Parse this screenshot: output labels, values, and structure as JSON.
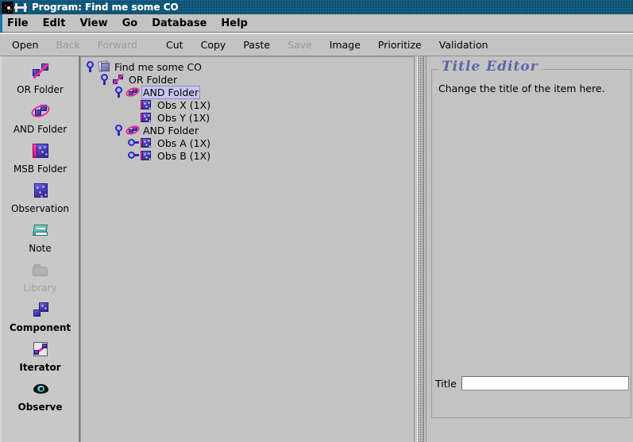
{
  "window": {
    "title": "Program: Find me some CO",
    "app_icon": "nebula-image-icon",
    "window_icon": "window-handles-icon"
  },
  "menubar": {
    "items": [
      {
        "label": "File"
      },
      {
        "label": "Edit"
      },
      {
        "label": "View"
      },
      {
        "label": "Go"
      },
      {
        "label": "Database"
      },
      {
        "label": "Help"
      }
    ]
  },
  "toolbar": {
    "buttons": [
      {
        "label": "Open",
        "enabled": true
      },
      {
        "label": "Back",
        "enabled": false
      },
      {
        "label": "Forward",
        "enabled": false
      },
      {
        "label": "Cut",
        "enabled": true
      },
      {
        "label": "Copy",
        "enabled": true
      },
      {
        "label": "Paste",
        "enabled": true
      },
      {
        "label": "Save",
        "enabled": false
      },
      {
        "label": "Image",
        "enabled": true
      },
      {
        "label": "Prioritize",
        "enabled": true
      },
      {
        "label": "Validation",
        "enabled": true
      }
    ]
  },
  "palette": {
    "items": [
      {
        "label": "OR Folder",
        "icon": "or-folder-icon",
        "enabled": true,
        "bold": false
      },
      {
        "label": "AND Folder",
        "icon": "and-folder-icon",
        "enabled": true,
        "bold": false
      },
      {
        "label": "MSB Folder",
        "icon": "msb-folder-icon",
        "enabled": true,
        "bold": false
      },
      {
        "label": "Observation",
        "icon": "observation-icon",
        "enabled": true,
        "bold": false
      },
      {
        "label": "Note",
        "icon": "note-icon",
        "enabled": true,
        "bold": false
      },
      {
        "label": "Library",
        "icon": "library-icon",
        "enabled": false,
        "bold": false
      },
      {
        "label": "Component",
        "icon": "component-icon",
        "enabled": true,
        "bold": true
      },
      {
        "label": "Iterator",
        "icon": "iterator-icon",
        "enabled": true,
        "bold": true
      },
      {
        "label": "Observe",
        "icon": "observe-eye-icon",
        "enabled": true,
        "bold": true
      }
    ]
  },
  "tree": {
    "nodes": [
      {
        "label": "Find me some CO",
        "icon": "program-doc-icon",
        "depth": 0,
        "toggle": "expanded",
        "selected": false
      },
      {
        "label": "OR Folder",
        "icon": "or-folder-icon",
        "depth": 1,
        "toggle": "expanded",
        "selected": false
      },
      {
        "label": "AND Folder",
        "icon": "and-folder-icon",
        "depth": 2,
        "toggle": "expanded",
        "selected": true
      },
      {
        "label": "Obs X (1X)",
        "icon": "observation-icon",
        "depth": 3,
        "toggle": "none",
        "selected": false
      },
      {
        "label": "Obs Y (1X)",
        "icon": "observation-icon",
        "depth": 3,
        "toggle": "none",
        "selected": false
      },
      {
        "label": "AND Folder",
        "icon": "and-folder-icon",
        "depth": 2,
        "toggle": "expanded",
        "selected": false
      },
      {
        "label": "Obs A (1X)",
        "icon": "observation-icon",
        "depth": 3,
        "toggle": "collapsed",
        "selected": false
      },
      {
        "label": "Obs B (1X)",
        "icon": "observation-icon",
        "depth": 3,
        "toggle": "collapsed",
        "selected": false
      }
    ]
  },
  "editor": {
    "panel_title": "Title Editor",
    "description": "Change the title of the item here.",
    "field_label": "Title",
    "field_value": "",
    "field_placeholder": ""
  },
  "colors": {
    "titlebar": "#1878a8",
    "face": "#c3c3c3",
    "accent_magenta": "#ee2a9a",
    "accent_blue": "#4a3fb0",
    "panel_title": "#5b66a8",
    "selection": "#c6c6ee",
    "disabled_text": "#9a9a9a"
  }
}
